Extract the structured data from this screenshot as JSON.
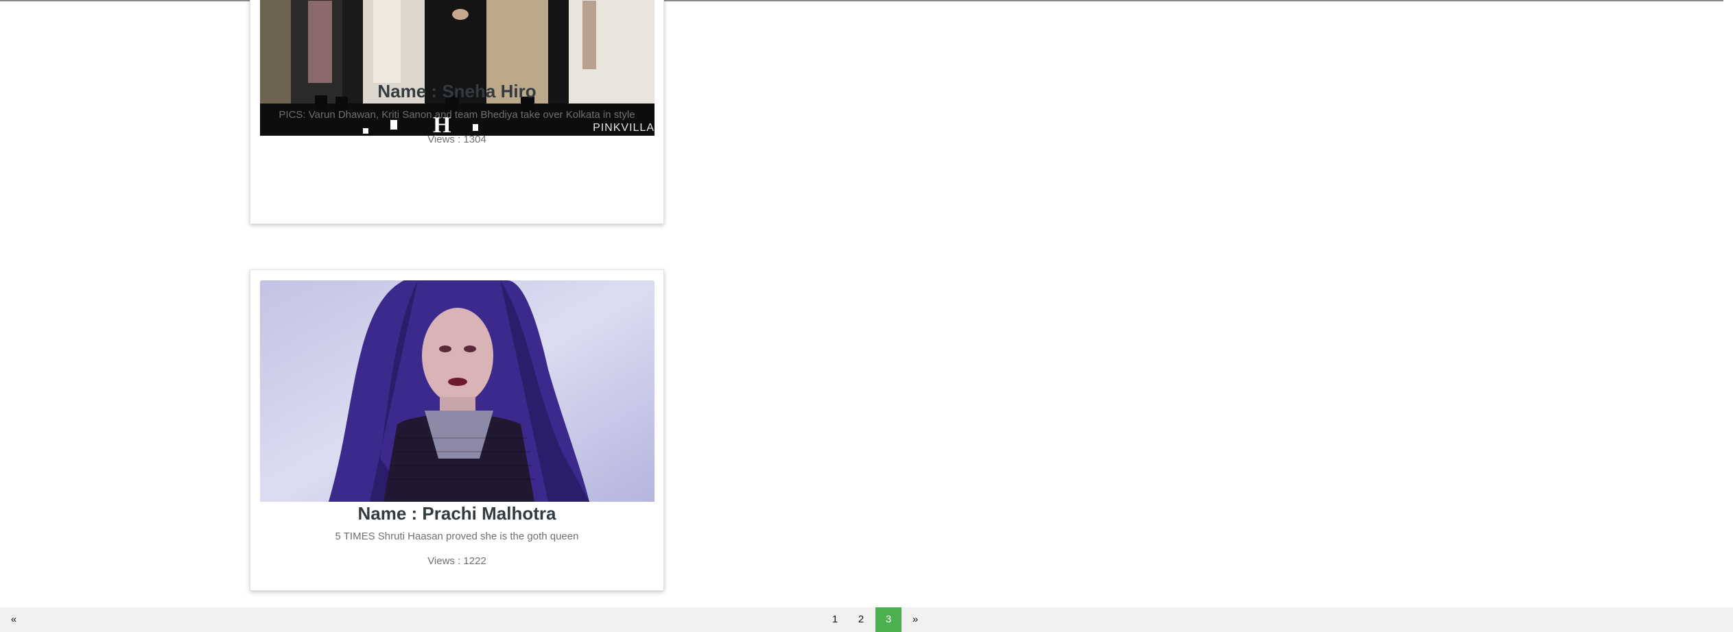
{
  "cards": [
    {
      "image_label": "group-photo",
      "watermark": "PINKVILLA",
      "name": "Name : Sneha Hiro",
      "description": "PICS: Varun Dhawan, Kriti Sanon and team Bhediya take over Kolkata in style",
      "views": "Views : 1304"
    },
    {
      "image_label": "portrait-photo",
      "name": "Name : Prachi Malhotra",
      "description": "5 TIMES Shruti Haasan proved she is the goth queen",
      "views": "Views : 1222"
    }
  ],
  "pagination": {
    "prev": "«",
    "next": "»",
    "pages": [
      "1",
      "2",
      "3"
    ],
    "active_page": "3",
    "active_color": "#4caf50"
  }
}
